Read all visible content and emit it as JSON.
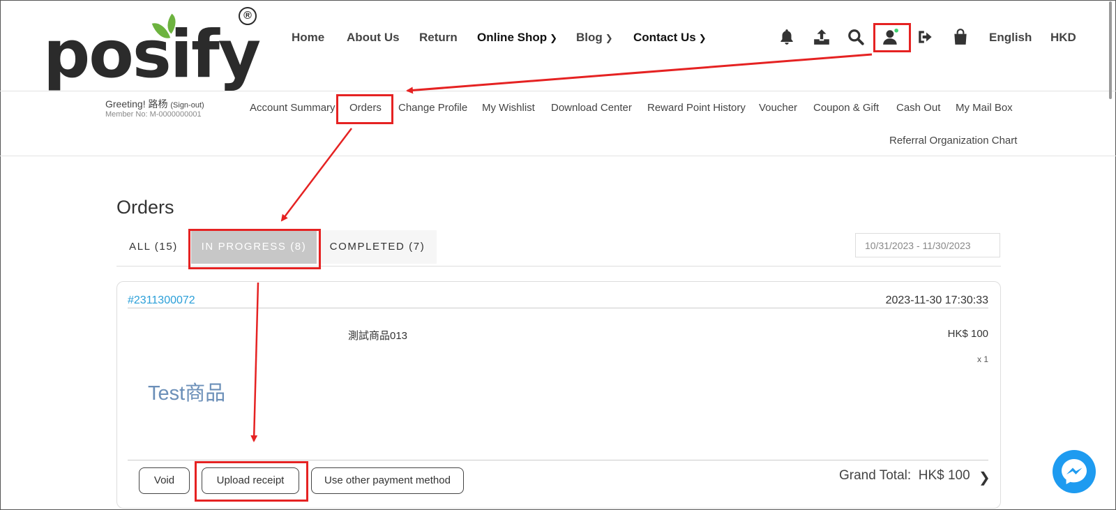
{
  "brand": {
    "logo_text": "posify",
    "registered_mark": "®"
  },
  "header": {
    "nav": [
      {
        "label": "Home"
      },
      {
        "label": "About Us"
      },
      {
        "label": "Return"
      },
      {
        "label": "Online Shop"
      },
      {
        "label": "Blog"
      },
      {
        "label": "Contact Us"
      }
    ],
    "icons": [
      "bell-icon",
      "upload-icon",
      "search-icon",
      "user-icon",
      "logout-icon",
      "shopping-bag-icon"
    ],
    "language": "English",
    "currency": "HKD"
  },
  "account": {
    "greeting": "Greeting! 路杨",
    "sign_out": "(Sign-out)",
    "member_no": "Member No: M-0000000001",
    "menu": [
      {
        "label": "Account Summary"
      },
      {
        "label": "Orders"
      },
      {
        "label": "Change Profile"
      },
      {
        "label": "My Wishlist"
      },
      {
        "label": "Download Center"
      },
      {
        "label": "Reward Point History"
      },
      {
        "label": "Voucher"
      },
      {
        "label": "Coupon & Gift"
      },
      {
        "label": "Cash Out"
      },
      {
        "label": "My Mail Box"
      },
      {
        "label": "Referral Organization Chart"
      }
    ]
  },
  "orders": {
    "title": "Orders",
    "tabs": [
      {
        "label": "ALL (15)"
      },
      {
        "label": "IN PROGRESS (8)",
        "active": true
      },
      {
        "label": "COMPLETED (7)"
      }
    ],
    "date_range": "10/31/2023 - 11/30/2023",
    "order": {
      "number": "#2311300072",
      "datetime": "2023-11-30 17:30:33",
      "item_name": "測試商品013",
      "item_price": "HK$ 100",
      "item_qty": "x 1",
      "item_image_text": "Test商品",
      "actions": [
        {
          "label": "Void"
        },
        {
          "label": "Upload receipt"
        },
        {
          "label": "Use other payment method"
        }
      ],
      "grand_total_label": "Grand Total:",
      "grand_total_value": "HK$ 100"
    }
  },
  "colors": {
    "annotation": "#e52222",
    "link": "#2a9fd8",
    "active_tab": "#c7c7c7",
    "messenger": "#1e9bf0",
    "leaf_green": "#6db33f"
  }
}
